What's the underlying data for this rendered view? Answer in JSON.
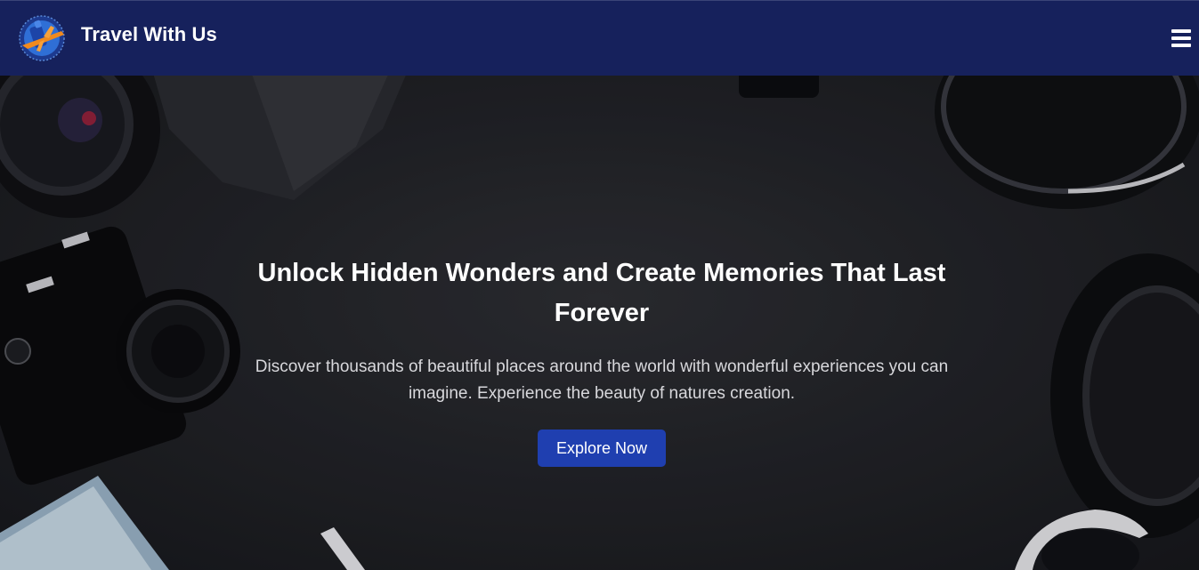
{
  "header": {
    "brand_name": "Travel With Us",
    "logo_icon": "travel-globe-plane-icon",
    "menu_icon": "hamburger-menu-icon",
    "background": "#16215c"
  },
  "hero": {
    "title": "Unlock Hidden Wonders and Create Memories That Last Forever",
    "subtitle": "Discover thousands of beautiful places around the world with wonderful experiences you can imagine. Experience the beauty of natures creation.",
    "cta_label": "Explore Now",
    "cta_color": "#1f3fb0",
    "background_image": "dark flat-lay of travel gear: camera, lens, headphones, map, toy airplane, sunglasses"
  }
}
